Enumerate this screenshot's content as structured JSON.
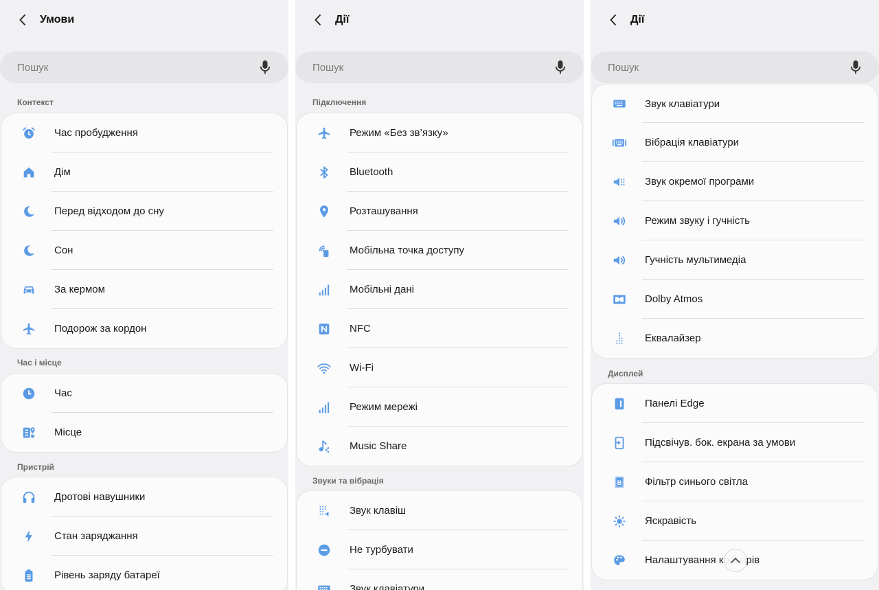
{
  "accent_color": "#5b9be6",
  "panels": [
    {
      "title": "Умови",
      "search_placeholder": "Пошук",
      "sections": [
        {
          "label": "Контекст",
          "items": [
            {
              "label": "Час пробудження",
              "icon": "alarm-icon"
            },
            {
              "label": "Дім",
              "icon": "home-icon"
            },
            {
              "label": "Перед відходом до сну",
              "icon": "moon-icon"
            },
            {
              "label": "Сон",
              "icon": "moon-icon"
            },
            {
              "label": "За кермом",
              "icon": "car-icon"
            },
            {
              "label": "Подорож за кордон",
              "icon": "airplane-icon"
            }
          ]
        },
        {
          "label": "Час і місце",
          "items": [
            {
              "label": "Час",
              "icon": "clock-icon"
            },
            {
              "label": "Місце",
              "icon": "map-pin-icon"
            }
          ]
        },
        {
          "label": "Пристрій",
          "items": [
            {
              "label": "Дротові навушники",
              "icon": "headphones-icon"
            },
            {
              "label": "Стан заряджання",
              "icon": "bolt-icon"
            },
            {
              "label": "Рівень заряду батареї",
              "icon": "battery-icon"
            }
          ]
        }
      ]
    },
    {
      "title": "Дії",
      "search_placeholder": "Пошук",
      "sections": [
        {
          "label": "Підключення",
          "items": [
            {
              "label": "Режим «Без зв’язку»",
              "icon": "airplane-icon"
            },
            {
              "label": "Bluetooth",
              "icon": "bluetooth-icon"
            },
            {
              "label": "Розташування",
              "icon": "location-pin-icon"
            },
            {
              "label": "Мобільна точка доступу",
              "icon": "hotspot-icon"
            },
            {
              "label": "Мобільні дані",
              "icon": "signal-bars-icon"
            },
            {
              "label": "NFC",
              "icon": "nfc-icon"
            },
            {
              "label": "Wi-Fi",
              "icon": "wifi-icon"
            },
            {
              "label": "Режим мережі",
              "icon": "signal-bars-icon"
            },
            {
              "label": "Music Share",
              "icon": "music-share-icon"
            }
          ]
        },
        {
          "label": "Звуки та вібрація",
          "items": [
            {
              "label": "Звук клавіш",
              "icon": "keypad-sound-icon"
            },
            {
              "label": "Не турбувати",
              "icon": "do-not-disturb-icon"
            },
            {
              "label": "Звук клавіатури",
              "icon": "keyboard-icon"
            }
          ]
        }
      ]
    },
    {
      "title": "Дії",
      "search_placeholder": "Пошук",
      "sections": [
        {
          "label": "",
          "items": [
            {
              "label": "Звук клавіатури",
              "icon": "keyboard-icon"
            },
            {
              "label": "Вібрація клавіатури",
              "icon": "keyboard-vibration-icon"
            },
            {
              "label": "Звук окремої програми",
              "icon": "app-sound-icon"
            },
            {
              "label": "Режим звуку і гучність",
              "icon": "volume-icon"
            },
            {
              "label": "Гучність мультимедіа",
              "icon": "volume-icon"
            },
            {
              "label": "Dolby Atmos",
              "icon": "dolby-icon"
            },
            {
              "label": "Еквалайзер",
              "icon": "equalizer-icon"
            }
          ]
        },
        {
          "label": "Дисплей",
          "items": [
            {
              "label": "Панелі Edge",
              "icon": "edge-panel-icon"
            },
            {
              "label": "Підсвічув. бок. екрана за умови",
              "icon": "edge-lighting-icon"
            },
            {
              "label": "Фільтр синього світла",
              "icon": "blue-light-filter-icon"
            },
            {
              "label": "Яскравість",
              "icon": "brightness-icon"
            },
            {
              "label": "Налаштування кольорів",
              "icon": "palette-icon"
            }
          ]
        }
      ]
    }
  ]
}
